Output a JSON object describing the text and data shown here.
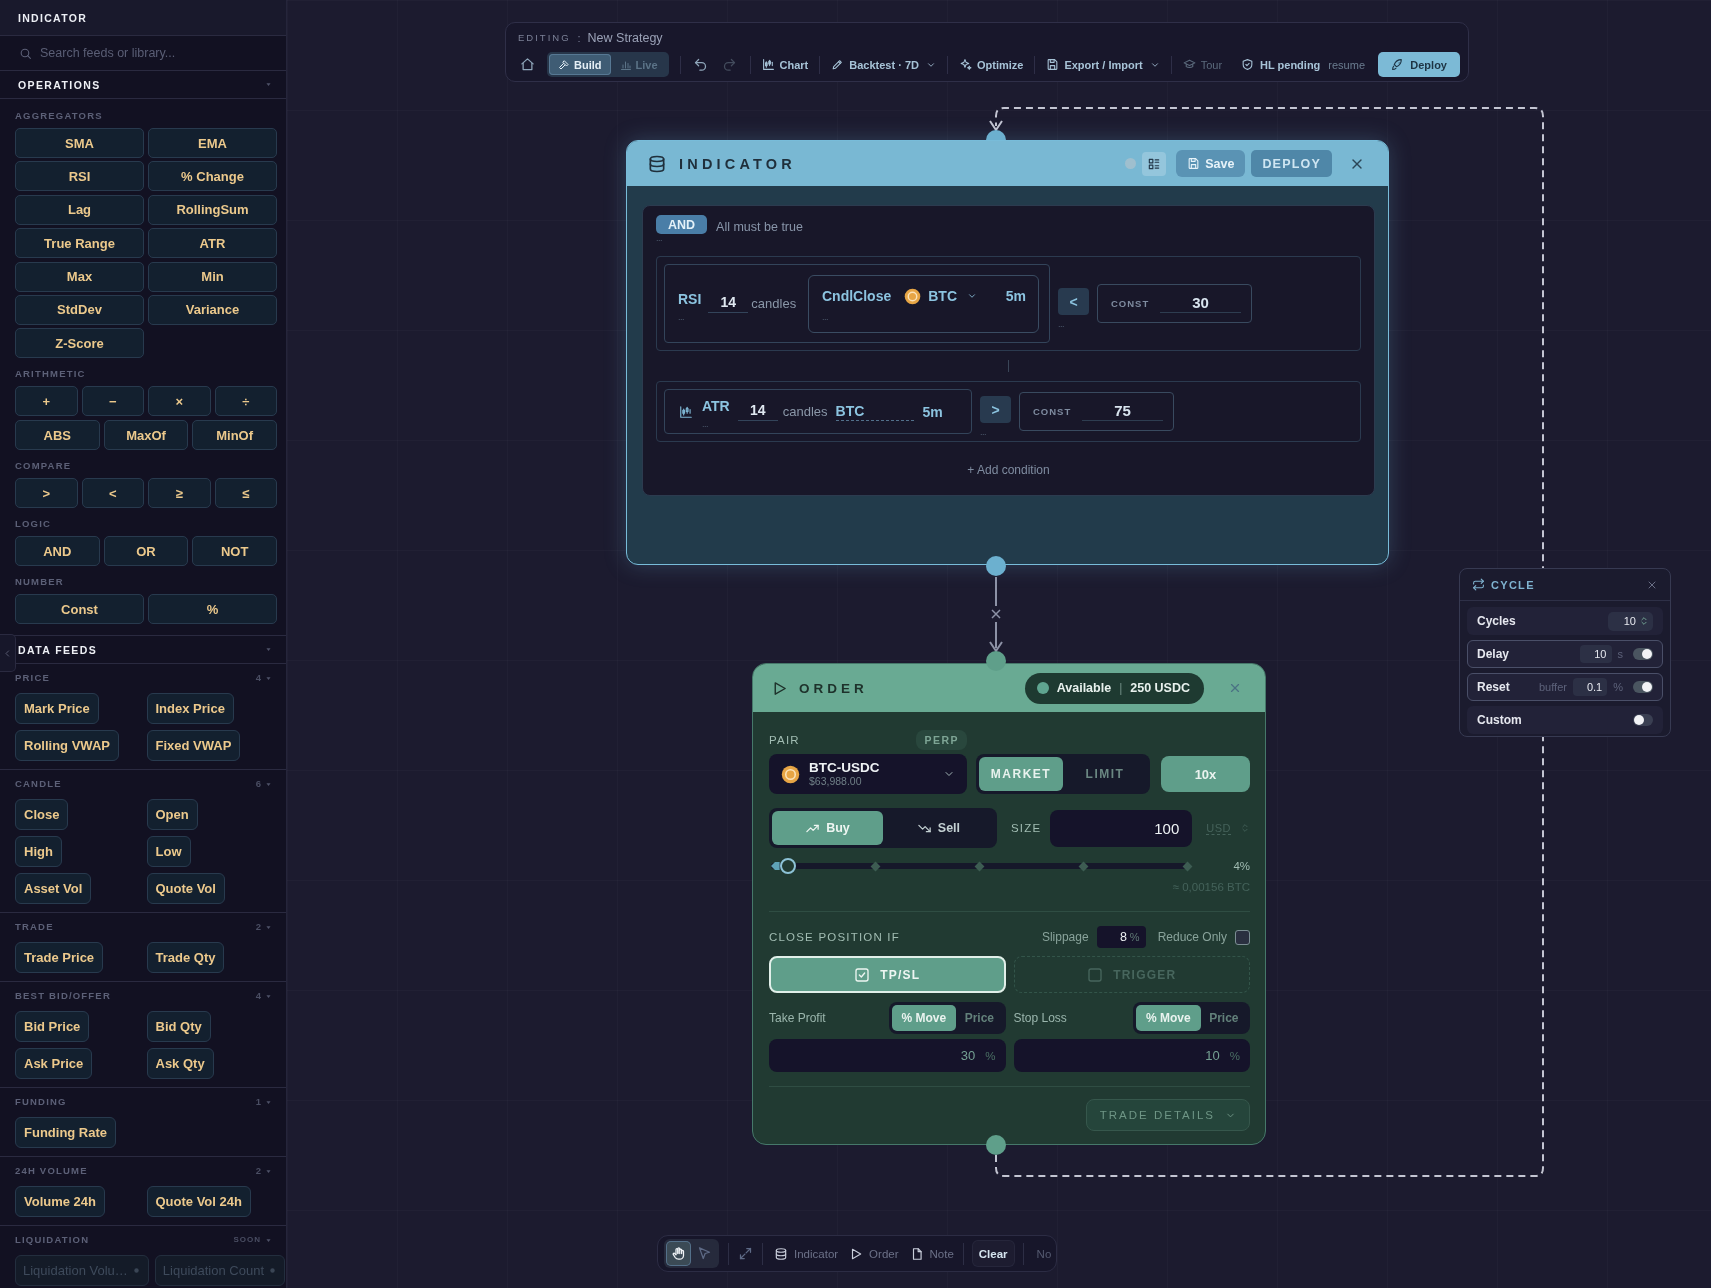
{
  "sidebar": {
    "title": "INDICATOR",
    "search": {
      "placeholder": "Search feeds or library..."
    },
    "operations": {
      "title": "OPERATIONS",
      "groups": [
        {
          "label": "AGGREGATORS",
          "rows": [
            {
              "buttons": [
                "SMA",
                "EMA"
              ]
            },
            {
              "buttons": [
                "RSI",
                "% Change"
              ]
            },
            {
              "buttons": [
                "Lag",
                "RollingSum"
              ]
            },
            {
              "buttons": [
                "True Range",
                "ATR"
              ]
            },
            {
              "buttons": [
                "Max",
                "Min"
              ]
            },
            {
              "buttons": [
                "StdDev",
                "Variance"
              ]
            },
            {
              "buttons": [
                "Z-Score"
              ]
            }
          ]
        },
        {
          "label": "ARITHMETIC",
          "rows": [
            {
              "buttons": [
                "+",
                "−",
                "×",
                "÷"
              ]
            },
            {
              "buttons": [
                "ABS",
                "MaxOf",
                "MinOf"
              ]
            }
          ]
        },
        {
          "label": "COMPARE",
          "rows": [
            {
              "buttons": [
                ">",
                "<",
                "≥",
                "≤"
              ]
            }
          ]
        },
        {
          "label": "LOGIC",
          "rows": [
            {
              "buttons": [
                "AND",
                "OR",
                "NOT"
              ]
            }
          ]
        },
        {
          "label": "NUMBER",
          "rows": [
            {
              "buttons": [
                "Const",
                "%"
              ]
            }
          ]
        }
      ]
    },
    "data_feeds": {
      "title": "DATA FEEDS",
      "groups": [
        {
          "label": "PRICE",
          "count": "4",
          "disabled": false,
          "items": [
            "Mark Price",
            "Index Price",
            "Rolling VWAP",
            "Fixed VWAP"
          ]
        },
        {
          "label": "CANDLE",
          "count": "6",
          "disabled": false,
          "items": [
            "Close",
            "Open",
            "High",
            "Low",
            "Asset Vol",
            "Quote Vol"
          ]
        },
        {
          "label": "TRADE",
          "count": "2",
          "disabled": false,
          "items": [
            "Trade Price",
            "Trade Qty"
          ]
        },
        {
          "label": "BEST BID/OFFER",
          "count": "4",
          "disabled": false,
          "items": [
            "Bid Price",
            "Bid Qty",
            "Ask Price",
            "Ask Qty"
          ]
        },
        {
          "label": "FUNDING",
          "count": "1",
          "disabled": false,
          "items": [
            "Funding Rate"
          ]
        },
        {
          "label": "24H VOLUME",
          "count": "2",
          "disabled": false,
          "items": [
            "Volume 24h",
            "Quote Vol 24h"
          ]
        },
        {
          "label": "LIQUIDATION",
          "status": "SOON",
          "disabled": true,
          "items": [
            "Liquidation Volu…",
            "Liquidation Count"
          ]
        }
      ]
    }
  },
  "toolbar": {
    "editing": {
      "label": "EDITING",
      "separator": ":",
      "name": "New Strategy"
    },
    "modes": [
      {
        "kind": "build",
        "label": "Build",
        "selected": true
      },
      {
        "kind": "live",
        "label": "Live",
        "selected": false
      }
    ],
    "history": [
      {
        "kind": "undo",
        "disabled": false
      },
      {
        "kind": "redo",
        "disabled": true
      }
    ],
    "actions": [
      {
        "kind": "chart",
        "label": "Chart",
        "dropdown": false,
        "disabled": false
      },
      {
        "kind": "backtest",
        "label": "Backtest · 7D",
        "dropdown": true,
        "disabled": false
      },
      {
        "kind": "optimize",
        "label": "Optimize",
        "dropdown": false,
        "disabled": false
      },
      {
        "kind": "export",
        "label": "Export / Import",
        "dropdown": true,
        "disabled": false
      },
      {
        "kind": "tour",
        "label": "Tour",
        "dropdown": false,
        "disabled": true
      }
    ],
    "status": {
      "label": "HL pending",
      "action": "resume"
    },
    "deploy": "Deploy"
  },
  "indicator_node": {
    "title": "INDICATOR",
    "save": "Save",
    "deploy": "DEPLOY",
    "logic": {
      "operator": "AND",
      "description": "All must be true",
      "menu": "..."
    },
    "conditions": [
      {
        "kind": "nested",
        "indicator": "RSI",
        "menu": "...",
        "period": "14",
        "unit": "candles",
        "source": {
          "name": "CndlClose",
          "asset": "BTC",
          "interval": "5m",
          "menu": "..."
        },
        "operator": {
          "symbol": "<",
          "menu": "..."
        },
        "constant": {
          "label": "CONST",
          "value": "30"
        }
      },
      {
        "kind": "inline",
        "indicator": "ATR",
        "menu": "...",
        "period": "14",
        "unit": "candles",
        "source": {
          "asset": "BTC",
          "interval": "5m"
        },
        "operator": {
          "symbol": ">",
          "menu": "..."
        },
        "constant": {
          "label": "CONST",
          "value": "75"
        }
      }
    ],
    "add_condition": "+ Add condition"
  },
  "order_node": {
    "title": "ORDER",
    "balance": {
      "label": "Available",
      "separator": "|",
      "value": "250 USDC"
    },
    "pair": {
      "label": "PAIR",
      "badge": "PERP",
      "symbol": "BTC-USDC",
      "price": "$63,988.00"
    },
    "order_types": [
      {
        "label": "MARKET",
        "selected": true
      },
      {
        "label": "LIMIT",
        "selected": false
      }
    ],
    "leverage": "10x",
    "sides": [
      {
        "kind": "buy",
        "label": "Buy",
        "selected": true
      },
      {
        "kind": "sell",
        "label": "Sell",
        "selected": false
      }
    ],
    "size": {
      "label": "SIZE",
      "value": "100",
      "unit": "USD",
      "level": 0.04,
      "reading": "4%",
      "estimate": "≈ 0,00156 BTC"
    },
    "close": {
      "label": "CLOSE POSITION IF",
      "slippage": {
        "label": "Slippage",
        "value": "8",
        "unit": "%"
      },
      "reduce_only": {
        "label": "Reduce Only",
        "checked": false
      },
      "modes": [
        {
          "label": "TP/SL",
          "checked": true
        },
        {
          "label": "TRIGGER",
          "checked": false
        }
      ],
      "targets": [
        {
          "label": "Take Profit",
          "options": [
            {
              "label": "% Move",
              "selected": true
            },
            {
              "label": "Price",
              "selected": false
            }
          ],
          "value": "30",
          "unit": "%"
        },
        {
          "label": "Stop Loss",
          "options": [
            {
              "label": "% Move",
              "selected": true
            },
            {
              "label": "Price",
              "selected": false
            }
          ],
          "value": "10",
          "unit": "%"
        }
      ]
    },
    "details": "TRADE DETAILS"
  },
  "cycle": {
    "title": "CYCLE",
    "rows": [
      {
        "kind": "stepper",
        "label": "Cycles",
        "value": "10"
      },
      {
        "kind": "toggle",
        "label": "Delay",
        "value": "10",
        "unit": "s",
        "on": true
      },
      {
        "kind": "toggle",
        "label": "Reset",
        "hint": "buffer",
        "value": "0.1",
        "unit": "%",
        "on": true
      },
      {
        "kind": "toggle",
        "label": "Custom",
        "on": false
      }
    ]
  },
  "canvas_tools": {
    "tools": [
      {
        "kind": "hand",
        "selected": true
      },
      {
        "kind": "pointer",
        "selected": false
      }
    ],
    "add": [
      {
        "kind": "indicator",
        "label": "Indicator"
      },
      {
        "kind": "order",
        "label": "Order"
      },
      {
        "kind": "note",
        "label": "Note"
      }
    ],
    "clear": "Clear",
    "cancel": "No"
  }
}
